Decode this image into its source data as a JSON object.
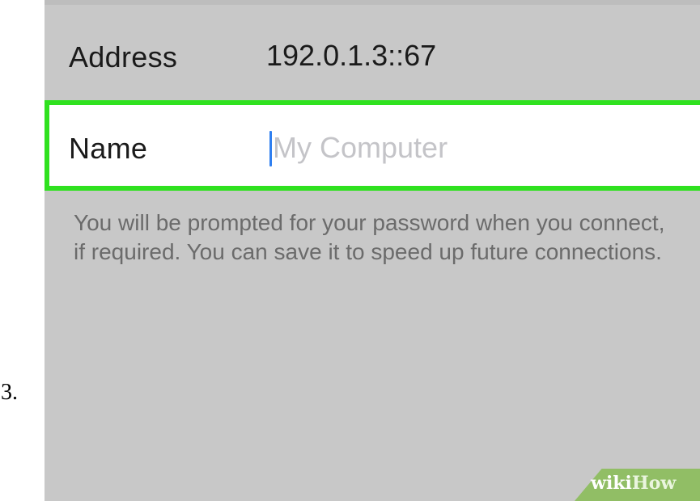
{
  "step": {
    "number": "3."
  },
  "form": {
    "address": {
      "label": "Address",
      "value": "192.0.1.3::67"
    },
    "name": {
      "label": "Name",
      "value": "",
      "placeholder": "My Computer"
    }
  },
  "help_text": "You will be prompted for your password when you connect, if required. You can save it to speed up future connections.",
  "watermark": {
    "wiki": "wiki",
    "how": "How"
  },
  "colors": {
    "highlight_border": "#2fe11f",
    "background": "#c8c8c8",
    "cursor": "#2f7ff0",
    "watermark": "#8bbd5a"
  }
}
